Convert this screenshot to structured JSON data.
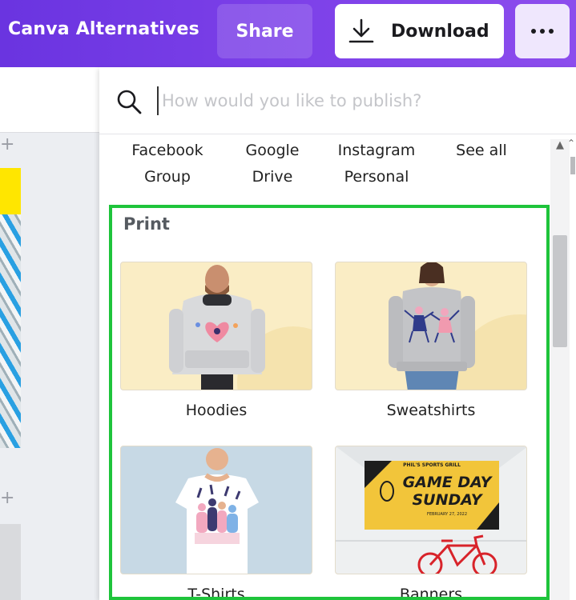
{
  "header": {
    "title": "Canva Alternatives",
    "share_label": "Share",
    "download_label": "Download",
    "more_icon": "more-horizontal-icon",
    "gradient_start": "#6a34e0",
    "gradient_end": "#8c4ded"
  },
  "search": {
    "value": "",
    "placeholder": "How would you like to publish?"
  },
  "publish_options": [
    {
      "line1": "Facebook",
      "line2": "Group"
    },
    {
      "line1": "Google",
      "line2": "Drive"
    },
    {
      "line1": "Instagram",
      "line2": "Personal"
    },
    {
      "line1": "See all",
      "line2": ""
    }
  ],
  "print_section": {
    "title": "Print",
    "highlight_color": "#1ec43b",
    "items": [
      {
        "label": "Hoodies"
      },
      {
        "label": "Sweatshirts"
      },
      {
        "label": "T-Shirts"
      },
      {
        "label": "Banners"
      }
    ],
    "banner_text": {
      "line1": "GAME DAY",
      "line2": "SUNDAY",
      "top": "PHIL'S SPORTS GRILL",
      "bottom": "FEBRUARY 27, 2022"
    }
  }
}
